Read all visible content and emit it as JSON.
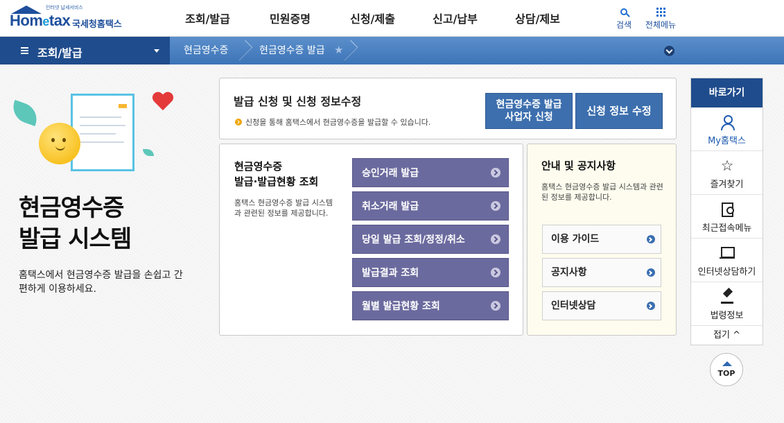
{
  "header": {
    "logo_small": "인터넷 납세서비스",
    "logo_main": "Hom",
    "logo_e": "e",
    "logo_tail": "tax",
    "logo_kr": "국세청홈택스",
    "nav": [
      "조회/발급",
      "민원증명",
      "신청/제출",
      "신고/납부",
      "상담/제보"
    ],
    "search_label": "검색",
    "all_menu_label": "전체메뉴"
  },
  "location": {
    "main": "조회/발급",
    "crumb1": "현금영수증",
    "crumb2": "현금영수증 발급"
  },
  "intro": {
    "title": "현금영수증\n발급 시스템",
    "desc": "홈택스에서 현금영수증 발급을 손쉽고 간편하게 이용하세요."
  },
  "apply_panel": {
    "title": "발급 신청 및 신청 정보수정",
    "note": "신청을 통해 홈택스에서 현금영수증을 발급할 수 있습니다.",
    "btn_apply": "현금영수증 발급\n사업자 신청",
    "btn_edit": "신청 정보 수정"
  },
  "issue_panel": {
    "title": "현금영수증\n발급·발급현황 조회",
    "desc": "홈택스 현금영수증 발급 시스템과 관련된 정보를 제공합니다.",
    "buttons": [
      "승인거래 발급",
      "취소거래 발급",
      "당일 발급 조회/정정/취소",
      "발급결과 조회",
      "월별 발급현황 조회"
    ]
  },
  "notice_panel": {
    "title": "안내 및 공지사항",
    "desc": "홈택스 현금영수증 발급 시스템과 관련된 정보를 제공합니다.",
    "buttons": [
      "이용 가이드",
      "공지사항",
      "인터넷상담"
    ]
  },
  "quick": {
    "title": "바로가기",
    "items": [
      "My홈택스",
      "즐겨찾기",
      "최근접속메뉴",
      "인터넷상담하기",
      "법령정보"
    ],
    "fold": "접기 ^",
    "top": "TOP"
  }
}
